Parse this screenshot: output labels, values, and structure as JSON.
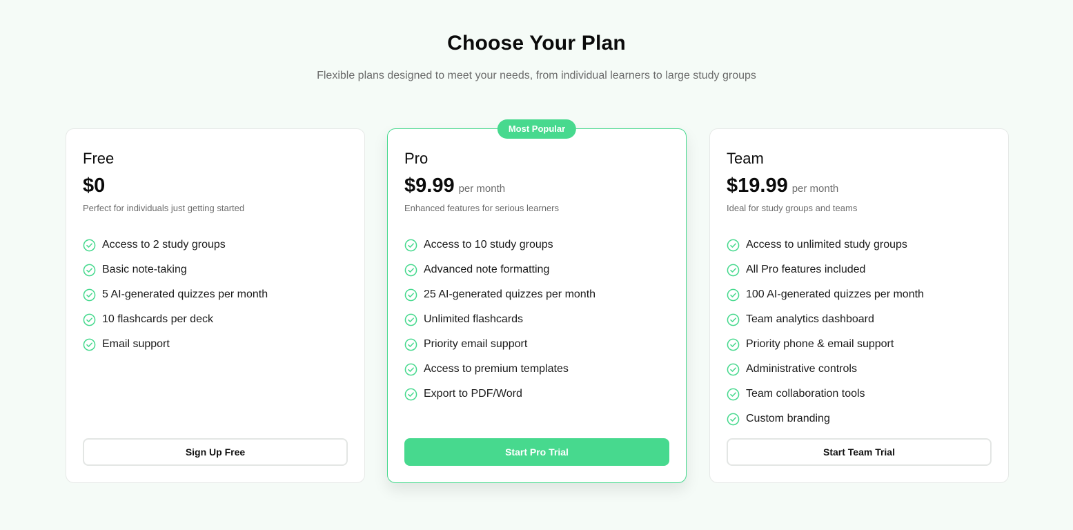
{
  "header": {
    "title": "Choose Your Plan",
    "subtitle": "Flexible plans designed to meet your needs, from individual learners to large study groups"
  },
  "colors": {
    "accent": "#47d98e",
    "background": "#f5fbf7"
  },
  "plans": [
    {
      "name": "Free",
      "price": "$0",
      "period": "",
      "description": "Perfect for individuals just getting started",
      "features": [
        "Access to 2 study groups",
        "Basic note-taking",
        "5 AI-generated quizzes per month",
        "10 flashcards per deck",
        "Email support"
      ],
      "button": "Sign Up Free"
    },
    {
      "name": "Pro",
      "badge": "Most Popular",
      "price": "$9.99",
      "period": "per month",
      "description": "Enhanced features for serious learners",
      "features": [
        "Access to 10 study groups",
        "Advanced note formatting",
        "25 AI-generated quizzes per month",
        "Unlimited flashcards",
        "Priority email support",
        "Access to premium templates",
        "Export to PDF/Word"
      ],
      "button": "Start Pro Trial"
    },
    {
      "name": "Team",
      "price": "$19.99",
      "period": "per month",
      "description": "Ideal for study groups and teams",
      "features": [
        "Access to unlimited study groups",
        "All Pro features included",
        "100 AI-generated quizzes per month",
        "Team analytics dashboard",
        "Priority phone & email support",
        "Administrative controls",
        "Team collaboration tools",
        "Custom branding"
      ],
      "button": "Start Team Trial"
    }
  ],
  "icons": {
    "feature": "check-circle-icon"
  }
}
